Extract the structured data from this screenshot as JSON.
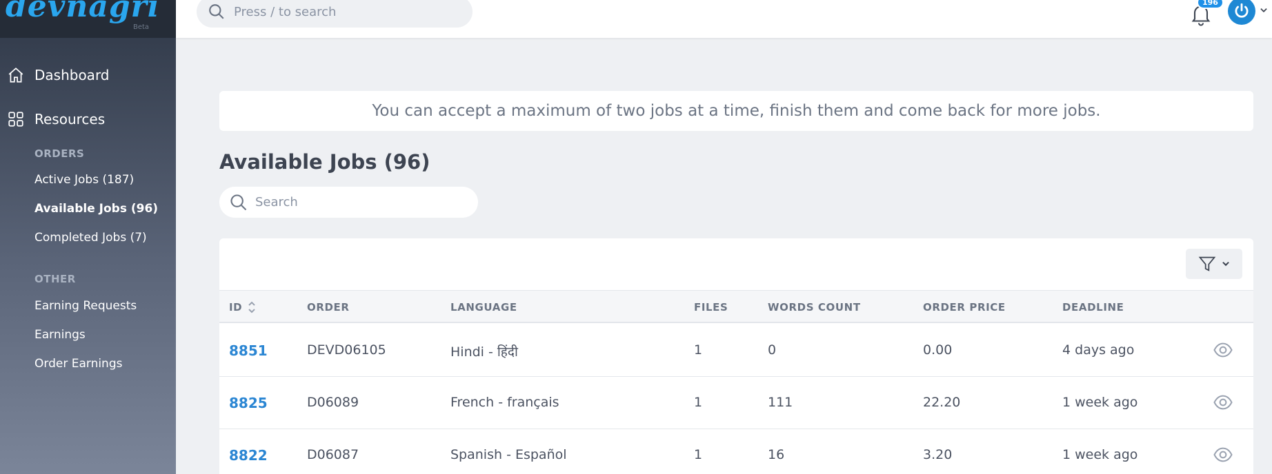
{
  "brand": {
    "logo_text": "devnagri",
    "beta_label": "Beta"
  },
  "sidebar": {
    "dashboard_label": "Dashboard",
    "resources_label": "Resources",
    "orders_section": "ORDERS",
    "orders_items": [
      {
        "label": "Active Jobs (187)"
      },
      {
        "label": "Available Jobs (96)"
      },
      {
        "label": "Completed Jobs (7)"
      }
    ],
    "other_section": "OTHER",
    "other_items": [
      {
        "label": "Earning Requests"
      },
      {
        "label": "Earnings"
      },
      {
        "label": "Order Earnings"
      }
    ]
  },
  "topbar": {
    "search_placeholder": "Press / to search",
    "notification_count": "196"
  },
  "notice": {
    "text": "You can accept a maximum of two jobs at a time, finish them and come back for more jobs."
  },
  "page": {
    "title": "Available Jobs (96)",
    "search_placeholder": "Search"
  },
  "table": {
    "headers": {
      "id": "ID",
      "order": "ORDER",
      "language": "LANGUAGE",
      "files": "FILES",
      "words": "WORDS COUNT",
      "price": "ORDER PRICE",
      "deadline": "DEADLINE"
    },
    "rows": [
      {
        "id": "8851",
        "order": "DEVD06105",
        "language": "Hindi - हिंदी",
        "files": "1",
        "words": "0",
        "price": "0.00",
        "deadline": "4 days ago"
      },
      {
        "id": "8825",
        "order": "D06089",
        "language": "French - français",
        "files": "1",
        "words": "111",
        "price": "22.20",
        "deadline": "1 week ago"
      },
      {
        "id": "8822",
        "order": "D06087",
        "language": "Spanish - Español",
        "files": "1",
        "words": "16",
        "price": "3.20",
        "deadline": "1 week ago"
      }
    ]
  },
  "colors": {
    "accent": "#2b86d3",
    "sidebar_top": "#2e3746",
    "badge": "#1e90e8"
  },
  "icons": [
    "home-icon",
    "grid-icon",
    "search-icon",
    "bell-icon",
    "power-icon",
    "chevron-down-icon",
    "filter-icon",
    "sort-icon",
    "eye-icon"
  ]
}
